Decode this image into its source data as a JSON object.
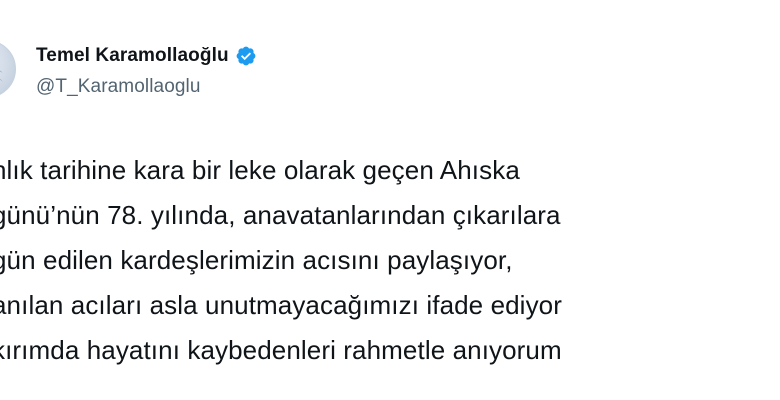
{
  "author": {
    "display_name": "Temel Karamollaoğlu",
    "handle": "@T_Karamollaoglu",
    "verified_icon": "verified-badge-icon",
    "verified_color": "#1d9bf0"
  },
  "tweet": {
    "lines": [
      "nlık tarihine kara bir leke olarak geçen Ahıska",
      "günü’nün 78. yılında, anavatanlarından çıkarılara",
      "gün edilen kardeşlerimizin acısını paylaşıyor,",
      "anılan acıları asla unutmayacağımızı ifade ediyor",
      "kırımda hayatını kaybedenleri rahmetle anıyorum"
    ]
  }
}
